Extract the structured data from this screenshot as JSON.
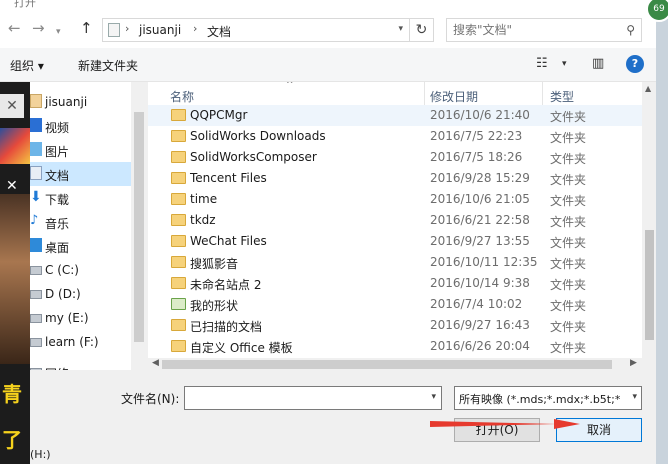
{
  "window": {
    "title": "打开"
  },
  "address": {
    "breadcrumbs": [
      "jisuanji",
      "文档"
    ],
    "separator": "›"
  },
  "search": {
    "placeholder": "搜索\"文档\""
  },
  "toolbar": {
    "organize_label": "组织 ▾",
    "new_folder_label": "新建文件夹"
  },
  "nav": {
    "items": [
      {
        "label": "jisuanji",
        "icon": "user-icon"
      },
      {
        "label": "视频",
        "icon": "video-icon"
      },
      {
        "label": "图片",
        "icon": "picture-icon"
      },
      {
        "label": "文档",
        "icon": "documents-icon",
        "selected": true
      },
      {
        "label": "下载",
        "icon": "download-icon"
      },
      {
        "label": "音乐",
        "icon": "music-icon"
      },
      {
        "label": "桌面",
        "icon": "desktop-icon"
      },
      {
        "label": "C (C:)",
        "icon": "drive-icon"
      },
      {
        "label": "D (D:)",
        "icon": "drive-icon"
      },
      {
        "label": "my (E:)",
        "icon": "drive-icon"
      },
      {
        "label": "learn (F:)",
        "icon": "drive-icon"
      },
      {
        "label": "网络",
        "icon": "network-icon"
      }
    ]
  },
  "columns": {
    "name": "名称",
    "date": "修改日期",
    "type": "类型"
  },
  "files": [
    {
      "name": "QQPCMgr",
      "date": "2016/10/6 21:40",
      "type": "文件夹"
    },
    {
      "name": "SolidWorks Downloads",
      "date": "2016/7/5 22:23",
      "type": "文件夹"
    },
    {
      "name": "SolidWorksComposer",
      "date": "2016/7/5 18:26",
      "type": "文件夹"
    },
    {
      "name": "Tencent Files",
      "date": "2016/9/28 15:29",
      "type": "文件夹"
    },
    {
      "name": "time",
      "date": "2016/10/6 21:05",
      "type": "文件夹"
    },
    {
      "name": "tkdz",
      "date": "2016/6/21 22:58",
      "type": "文件夹"
    },
    {
      "name": "WeChat Files",
      "date": "2016/9/27 13:55",
      "type": "文件夹"
    },
    {
      "name": "搜狐影音",
      "date": "2016/10/11 12:35",
      "type": "文件夹"
    },
    {
      "name": "未命名站点 2",
      "date": "2016/10/14 9:38",
      "type": "文件夹"
    },
    {
      "name": "我的形状",
      "date": "2016/7/4 10:02",
      "type": "文件夹"
    },
    {
      "name": "已扫描的文档",
      "date": "2016/9/27 16:43",
      "type": "文件夹"
    },
    {
      "name": "自定义 Office 模板",
      "date": "2016/6/26 20:04",
      "type": "文件夹"
    }
  ],
  "bottom": {
    "filename_label": "文件名(N):",
    "filename_value": "",
    "filetype_value": "所有映像 (*.mds;*.mdx;*.b5t;*",
    "open_label": "打开(O)",
    "cancel_label": "取消"
  },
  "background": {
    "badge_text": "69",
    "drive_hint": "(H:)",
    "overlay_text": [
      "青",
      "了"
    ]
  },
  "colors": {
    "accent": "#0078d7",
    "selected_bg": "#cce8ff",
    "folder": "#f6d27b",
    "arrow": "#e63a2e"
  }
}
